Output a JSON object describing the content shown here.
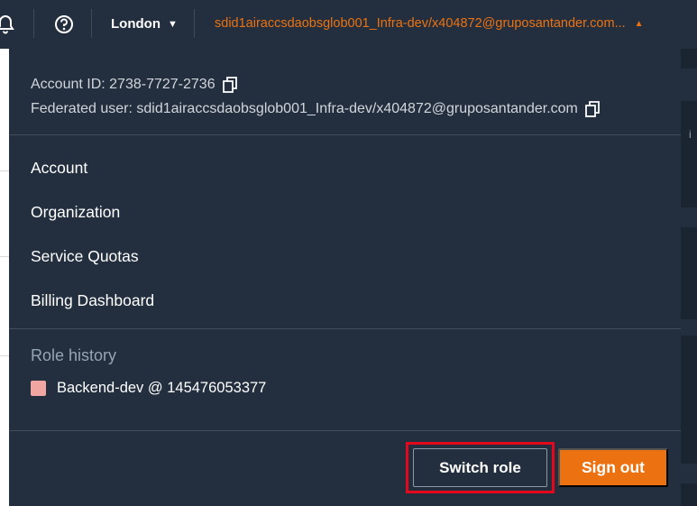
{
  "header": {
    "region": "London",
    "user_label": "sdid1airaccsdaobsglob001_Infra-dev/x404872@gruposantander.com..."
  },
  "account": {
    "account_id_label": "Account ID: 2738-7727-2736",
    "federated_user_label": "Federated user: sdid1airaccsdaobsglob001_Infra-dev/x404872@gruposantander.com"
  },
  "menu": {
    "items": [
      {
        "label": "Account"
      },
      {
        "label": "Organization"
      },
      {
        "label": "Service Quotas"
      },
      {
        "label": "Billing Dashboard"
      }
    ]
  },
  "role_history": {
    "heading": "Role history",
    "items": [
      {
        "label": "Backend-dev @ 145476053377",
        "color": "#f2a6a1"
      }
    ]
  },
  "actions": {
    "switch_role": "Switch role",
    "sign_out": "Sign out"
  },
  "background": {
    "glyph_1": "i"
  },
  "icons": [
    "bell-icon",
    "help-icon",
    "caret-down-icon",
    "caret-up-icon",
    "copy-icon"
  ],
  "colors": {
    "nav_bg": "#232f3e",
    "accent_orange": "#ec7211",
    "highlight_red": "#e3081b"
  }
}
